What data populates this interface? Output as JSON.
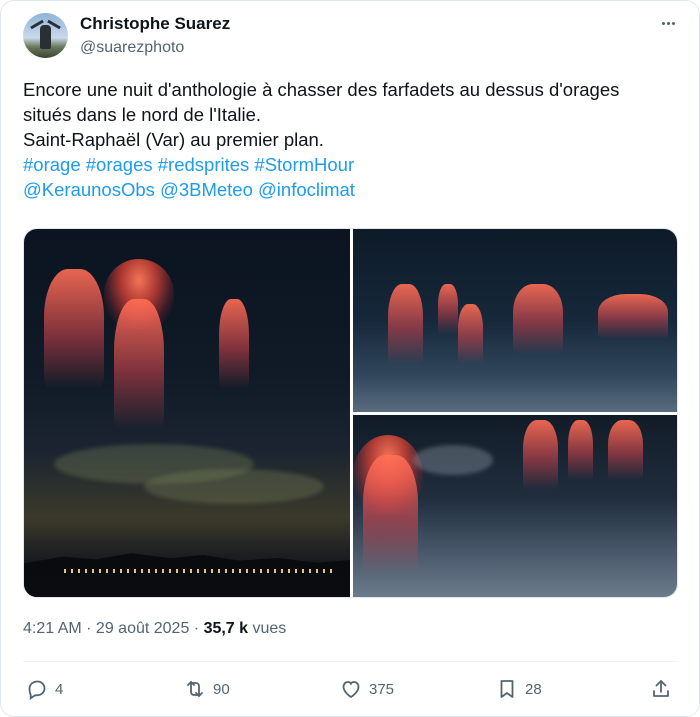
{
  "author": {
    "name": "Christophe Suarez",
    "handle": "@suarezphoto"
  },
  "tweet": {
    "line1": "Encore une nuit d'anthologie à chasser des farfadets au dessus d'orages",
    "line2": "situés dans le nord de l'Italie.",
    "line3": "Saint-Raphaël (Var) au premier plan.",
    "hashtags": [
      "#orage",
      "#orages",
      "#redsprites",
      "#StormHour"
    ],
    "mentions": [
      "@KeraunosObs",
      "@3BMeteo",
      "@infoclimat"
    ]
  },
  "meta": {
    "time": "4:21 AM",
    "sep1": " · ",
    "date": "29 août 2025",
    "sep2": " · ",
    "views_count": "35,7 k",
    "views_label": " vues"
  },
  "actions": {
    "replies": "4",
    "reposts": "90",
    "likes": "375",
    "bookmarks": "28"
  },
  "colors": {
    "link": "#1d9bf0",
    "secondary": "#536471",
    "sprite_red": "#ff6e55"
  }
}
